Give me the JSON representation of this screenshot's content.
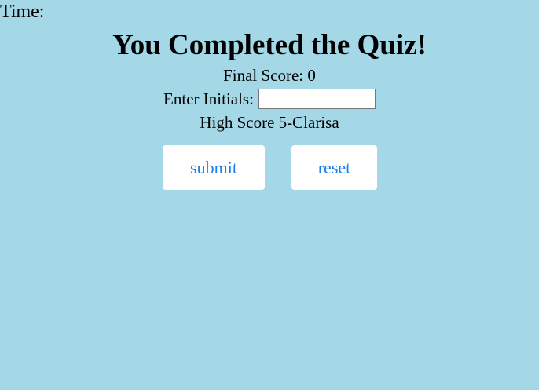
{
  "timer": {
    "label": "Time:"
  },
  "title": "You Completed the Quiz!",
  "final_score": "Final Score: 0",
  "initials": {
    "label": "Enter Initials:",
    "value": "",
    "placeholder": ""
  },
  "high_score": "High Score 5-Clarisa",
  "buttons": {
    "submit": "submit",
    "reset": "reset"
  },
  "colors": {
    "background": "#a5d8e6",
    "button_text": "#1a7ff0"
  }
}
